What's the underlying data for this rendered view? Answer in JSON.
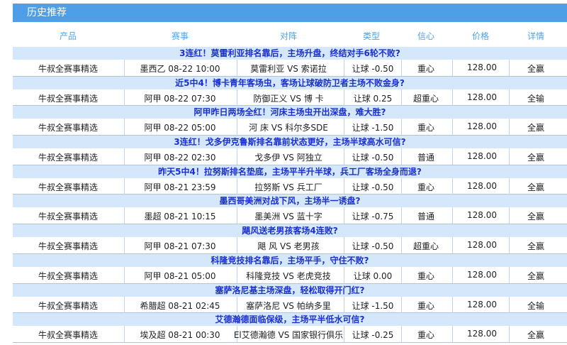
{
  "panel": {
    "title": "历史推荐"
  },
  "columns": {
    "product": "产品",
    "event": "赛事",
    "match": "对阵",
    "type": "类型",
    "confidence": "信心",
    "price": "价格",
    "detail": "详情"
  },
  "rows": [
    {
      "title": "3连红！莫雷利亚排名靠后，主场升盘，终结对手6轮不败?",
      "product": "牛叔全赛事精选",
      "event": "墨西乙 08-22 10:00",
      "match": "莫雷利亚 VS 索诺拉",
      "type": "让球 -0.50",
      "confidence": "重心",
      "price": "128.00",
      "detail": "全赢"
    },
    {
      "title": "近5中4！博卡青年客场虫，客场让球破防卫者主场不败金身?",
      "product": "牛叔全赛事精选",
      "event": "阿甲 08-22 07:30",
      "match": "防御正义 VS 博 卡",
      "type": "让球 0.25",
      "confidence": "超重心",
      "price": "128.00",
      "detail": "全输"
    },
    {
      "title": "阿甲昨日两场全红！河床主场虫开出深盘，难大胜?",
      "product": "牛叔全赛事精选",
      "event": "阿甲 08-22 05:00",
      "match": "河 床 VS 科尔多SDE",
      "type": "让球 -1.50",
      "confidence": "重心",
      "price": "128.00",
      "detail": "全赢"
    },
    {
      "title": "3连红！戈多伊克鲁斯排名靠前状态更好，主场半球高水可信?",
      "product": "牛叔全赛事精选",
      "event": "阿甲 08-22 02:30",
      "match": "戈多伊 VS 阿独立",
      "type": "让球 -0.50",
      "confidence": "普通",
      "price": "128.00",
      "detail": "全赢"
    },
    {
      "title": "昨天5中4！拉努斯排名垫底，主场平半升半球，兵工厂客场全身而退?",
      "product": "牛叔全赛事精选",
      "event": "阿甲 08-21 23:59",
      "match": "拉努斯 VS 兵工厂",
      "type": "让球 -0.50",
      "confidence": "重心",
      "price": "128.00",
      "detail": "全赢"
    },
    {
      "title": "墨西哥美洲对战下风，主场半一诱盘?",
      "product": "牛叔全赛事精选",
      "event": "墨超 08-21 10:15",
      "match": "墨美洲 VS 蓝十字",
      "type": "让球 -0.75",
      "confidence": "普通",
      "price": "128.00",
      "detail": "全赢"
    },
    {
      "title": "飓风送老男孩客场4连败?",
      "product": "牛叔全赛事精选",
      "event": "阿甲 08-21 07:30",
      "match": "飓 风 VS 老男孩",
      "type": "让球 -0.50",
      "confidence": "超重心",
      "price": "128.00",
      "detail": "全赢"
    },
    {
      "title": "科隆竞技排名靠后，主场平手，守住不败?",
      "product": "牛叔全赛事精选",
      "event": "阿甲 08-21 05:00",
      "match": "科隆竞技 VS 老虎竞技",
      "type": "让球 0.00",
      "confidence": "重心",
      "price": "128.00",
      "detail": "全赢"
    },
    {
      "title": "塞萨洛尼基主场深盘，轻松取得开门红?",
      "product": "牛叔全赛事精选",
      "event": "希腊超 08-21 02:45",
      "match": "塞萨洛尼 VS 帕纳多里",
      "type": "让球 -1.50",
      "confidence": "重心",
      "price": "128.00",
      "detail": "全输"
    },
    {
      "title": "艾德瀚德面临保级，主场平半低水可信?",
      "product": "牛叔全赛事精选",
      "event": "埃及超 08-21 00:30",
      "match": "El艾德瀚德 VS 国家银行俱乐",
      "type": "让球 -0.25",
      "confidence": "重心",
      "price": "128.00",
      "detail": "全赢"
    }
  ]
}
